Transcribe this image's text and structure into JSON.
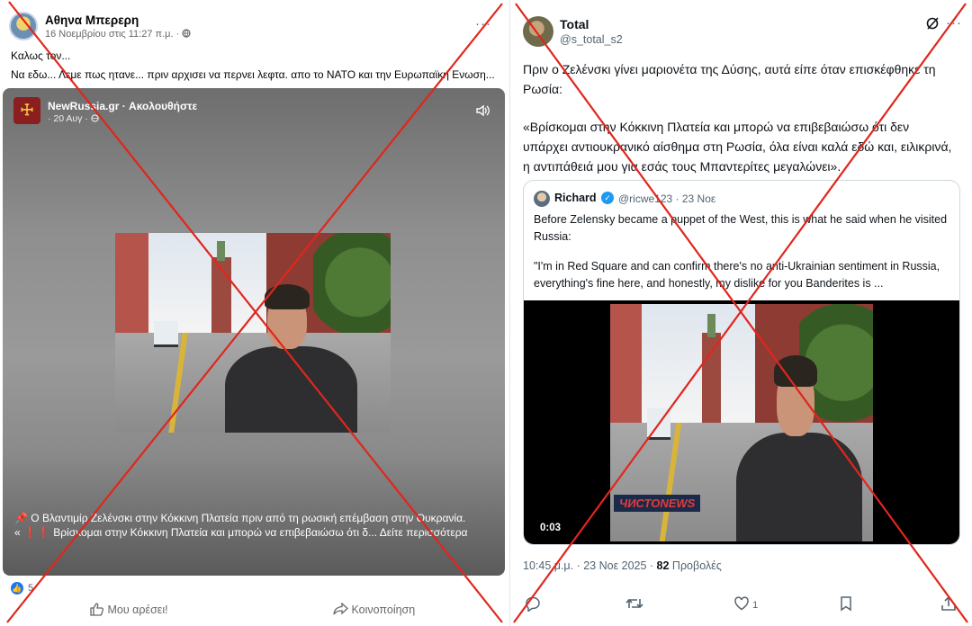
{
  "facebook": {
    "author_name": "Αθηνα Μπερερη",
    "post_date": "16 Νοεμβρίου στις 11:27 π.μ. · ",
    "more_label": "···",
    "text_line1": "Καλως τον...",
    "text_line2": "Να εδω... Λεμε πως ητανε... πριν αρχισει να περνει λεφτα. απο το ΝΑΤΟ και την Ευρωπαϊκη Ενωση...",
    "shared": {
      "page_name": "NewRussia.gr · Ακολουθήστε",
      "page_date": "· 20 Αυγ · ",
      "caption_line1": "📌 Ο Βλαντιμίρ Ζελένσκι στην Κόκκινη Πλατεία πριν από τη ρωσική επέμβαση στην Ουκρανία.",
      "caption_line2": "« ❗❗ Βρίσκομαι στην Κόκκινη Πλατεία και μπορώ να επιβεβαιώσω ότι δ... Δείτε περισσότερα"
    },
    "like_count": "5",
    "like_button": "Μου αρέσει!",
    "share_button": "Κοινοποίηση"
  },
  "twitter": {
    "author_name": "Total",
    "author_handle": "@s_total_s2",
    "more_label": "···",
    "text_para1": "Πριν ο Ζελένσκι γίνει μαριονέτα της Δύσης, αυτά είπε όταν επισκέφθηκε τη Ρωσία:",
    "text_para2": "«Βρίσκομαι στην Κόκκινη Πλατεία και μπορώ να επιβεβαιώσω ότι δεν υπάρχει αντιουκρανικό αίσθημα στη Ρωσία, όλα είναι καλά εδώ και, ειλικρινά, η αντιπάθειά μου για εσάς τους Μπαντερίτες μεγαλώνει».",
    "quote": {
      "author_name": "Richard",
      "author_handle": "@ricwe123 · 23 Νοε",
      "text_para1": "Before Zelensky became a puppet of the West, this is what he said when he visited Russia:",
      "text_para2": "\"I'm in Red Square and can confirm there's no anti-Ukrainian sentiment in Russia, everything's fine here, and honestly, my dislike for you Banderites is ...",
      "video_time": "0:03",
      "watermark": "ЧИСТОNEWS"
    },
    "timestamp": "10:45 μ.μ. · 23 Νοε 2025 · ",
    "views_count": "82",
    "views_label": " Προβολές",
    "likes_count": "1"
  },
  "colors": {
    "cross_red": "#e0261d",
    "fb_blue": "#1877f2",
    "tw_blue": "#1d9bf0"
  },
  "icons": [
    "globe-icon",
    "speaker-icon",
    "like-thumb-icon",
    "share-arrow-icon",
    "grok-icon",
    "reply-icon",
    "retweet-icon",
    "heart-icon",
    "bookmark-icon",
    "upload-icon",
    "verified-badge-icon"
  ]
}
